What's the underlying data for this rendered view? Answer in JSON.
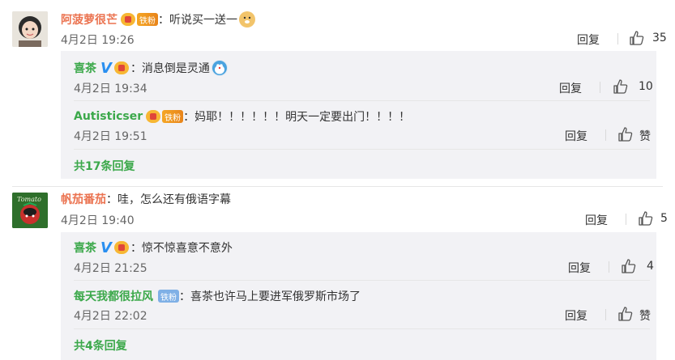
{
  "comments": [
    {
      "user": "阿菠萝很芒",
      "badge": "铁粉",
      "text": "：听说买一送一",
      "time": "4月2日 19:26",
      "reply_label": "回复",
      "likes": "35",
      "replies": [
        {
          "user": "喜茶",
          "text": "：消息倒是灵通",
          "time": "4月2日 19:34",
          "reply_label": "回复",
          "likes": "10"
        },
        {
          "user": "Autisticser",
          "badge": "铁粉",
          "text": "：妈耶！！！！！！明天一定要出门！！！！",
          "time": "4月2日 19:51",
          "reply_label": "回复",
          "likes": "赞"
        }
      ],
      "more": "共17条回复"
    },
    {
      "user": "帆茄番茄",
      "text": "：哇，怎么还有俄语字幕",
      "time": "4月2日 19:40",
      "reply_label": "回复",
      "likes": "5",
      "avatar_text": "Tomato",
      "replies": [
        {
          "user": "喜茶",
          "text": "：惊不惊喜意不意外",
          "time": "4月2日 21:25",
          "reply_label": "回复",
          "likes": "4"
        },
        {
          "user": "每天我都很拉风",
          "badge": "铁粉",
          "text": "：喜茶也许马上要进军俄罗斯市场了",
          "time": "4月2日 22:02",
          "reply_label": "回复",
          "likes": "赞"
        }
      ],
      "more": "共4条回复"
    }
  ],
  "icons": {
    "like": "thumbs-up-icon",
    "verified": "v-badge-icon",
    "crown": "crown-badge-icon"
  },
  "colors": {
    "username_orange": "#eb7350",
    "username_green": "#3ba84a",
    "reply_bg": "#f2f2f5",
    "verified_blue": "#2a8ff0"
  }
}
